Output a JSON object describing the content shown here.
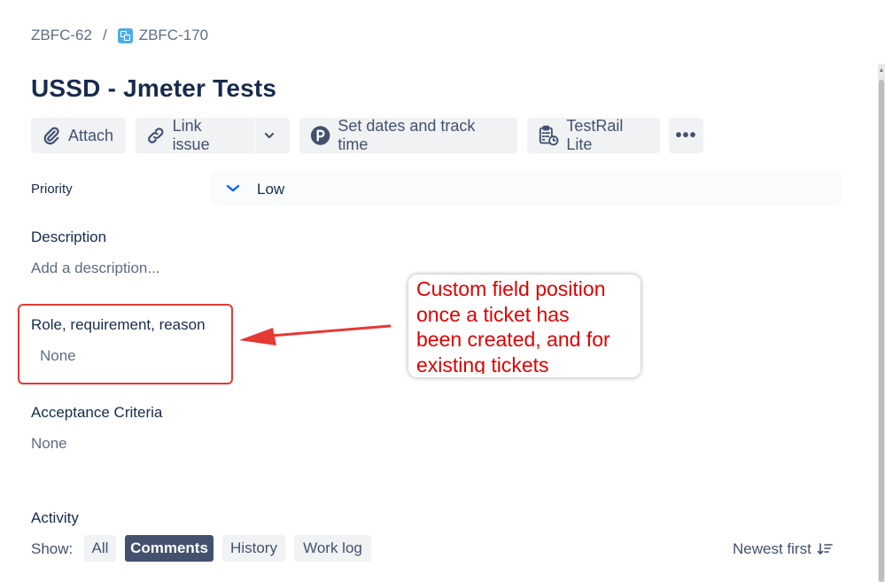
{
  "breadcrumb": {
    "parent": "ZBFC-62",
    "separator": "/",
    "current": "ZBFC-170"
  },
  "issue": {
    "title": "USSD - Jmeter Tests"
  },
  "toolbar": {
    "attach": "Attach",
    "link_issue": "Link issue",
    "set_dates": "Set dates and track time",
    "testrail": "TestRail Lite",
    "more": "•••"
  },
  "fields": {
    "priority": {
      "label": "Priority",
      "value": "Low"
    },
    "description": {
      "label": "Description",
      "placeholder": "Add a description..."
    },
    "role": {
      "label": "Role, requirement, reason",
      "value": "None"
    },
    "acceptance": {
      "label": "Acceptance Criteria",
      "value": "None"
    }
  },
  "activity": {
    "label": "Activity",
    "show_label": "Show:",
    "filters": [
      "All",
      "Comments",
      "History",
      "Work log"
    ],
    "active_filter": "Comments",
    "sort": "Newest first"
  },
  "annotation": {
    "text": "Custom field position\nonce a ticket has\nbeen created, and for\nexisting tickets",
    "color": "#e00000"
  },
  "colors": {
    "priority_icon": "#0065ff",
    "active_chip": "#42526e"
  }
}
